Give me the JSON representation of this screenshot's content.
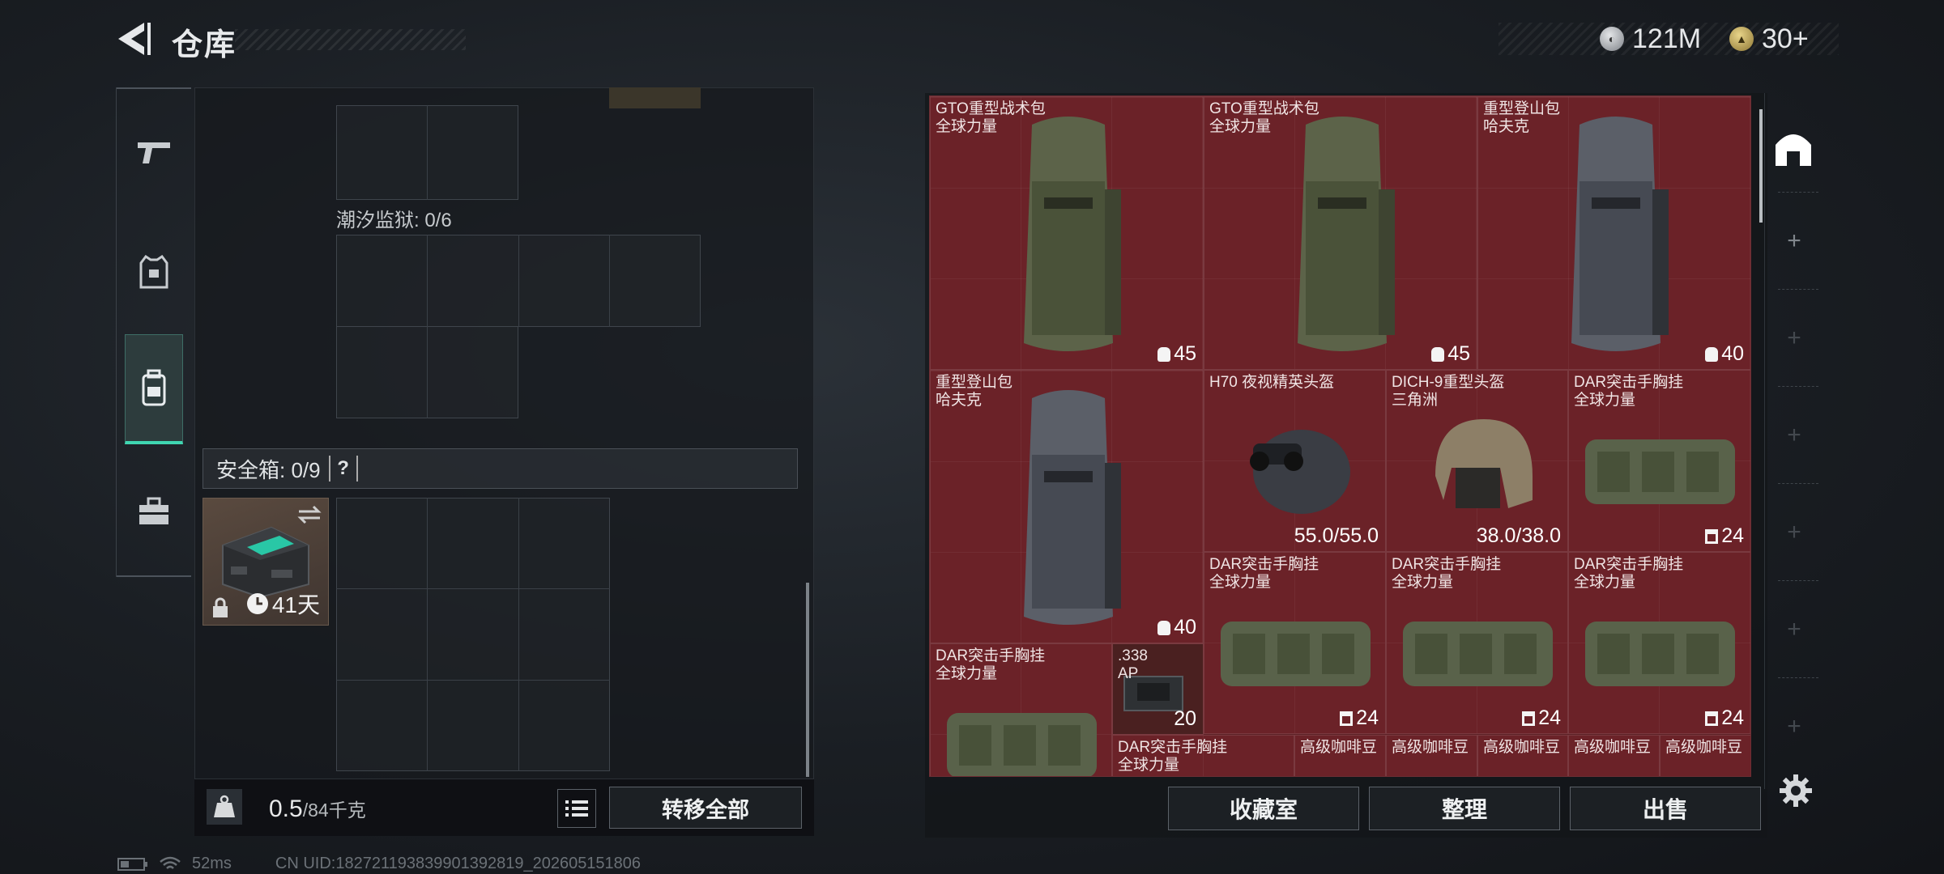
{
  "header": {
    "title": "仓库",
    "currency_silver": "121M",
    "currency_gold": "30+"
  },
  "left_panel": {
    "tide_prison_label": "潮汐监狱: 0/6",
    "safebox_label": "安全箱: 0/9",
    "safebox_help": "?",
    "safe_case_days": "41天",
    "weight_value": "0.5",
    "weight_capacity": "/84千克",
    "transfer_all": "转移全部"
  },
  "storage_items": [
    {
      "name": "GTO重型战术包",
      "sub": "全球力量",
      "count": "45"
    },
    {
      "name": "GTO重型战术包",
      "sub": "全球力量",
      "count": "45"
    },
    {
      "name": "重型登山包",
      "sub": "哈夫克",
      "count": "40"
    },
    {
      "name": "重型登山包",
      "sub": "哈夫克",
      "count": "40"
    },
    {
      "name": "H70 夜视精英头盔",
      "sub": "",
      "count": "55.0/55.0"
    },
    {
      "name": "DICH-9重型头盔",
      "sub": "三角洲",
      "count": "38.0/38.0"
    },
    {
      "name": "DAR突击手胸挂",
      "sub": "全球力量",
      "count": "24"
    },
    {
      "name": "DAR突击手胸挂",
      "sub": "全球力量",
      "count": "24"
    },
    {
      "name": "DAR突击手胸挂",
      "sub": "全球力量",
      "count": "24"
    },
    {
      "name": "DAR突击手胸挂",
      "sub": "全球力量",
      "count": "24"
    },
    {
      "name": "DAR突击手胸挂",
      "sub": "全球力量",
      "count": ""
    },
    {
      "name": ".338",
      "sub": "AP",
      "count": "20"
    },
    {
      "name": "DAR突击手胸挂",
      "sub": "全球力量",
      "count": ""
    },
    {
      "name": "高级咖啡豆",
      "sub": "",
      "count": ""
    },
    {
      "name": "高级咖啡豆",
      "sub": "",
      "count": ""
    },
    {
      "name": "高级咖啡豆",
      "sub": "",
      "count": ""
    },
    {
      "name": "高级咖啡豆",
      "sub": "",
      "count": ""
    },
    {
      "name": "高级咖啡豆",
      "sub": "",
      "count": ""
    }
  ],
  "buttons": {
    "collection_room": "收藏室",
    "organize": "整理",
    "sell": "出售"
  },
  "status_bar": {
    "ping": "52ms",
    "uid": "CN UID:18272119383990139281​9_202605151806"
  },
  "colors": {
    "accent": "#3fd6b1",
    "storage_bg": "#6b2228"
  }
}
